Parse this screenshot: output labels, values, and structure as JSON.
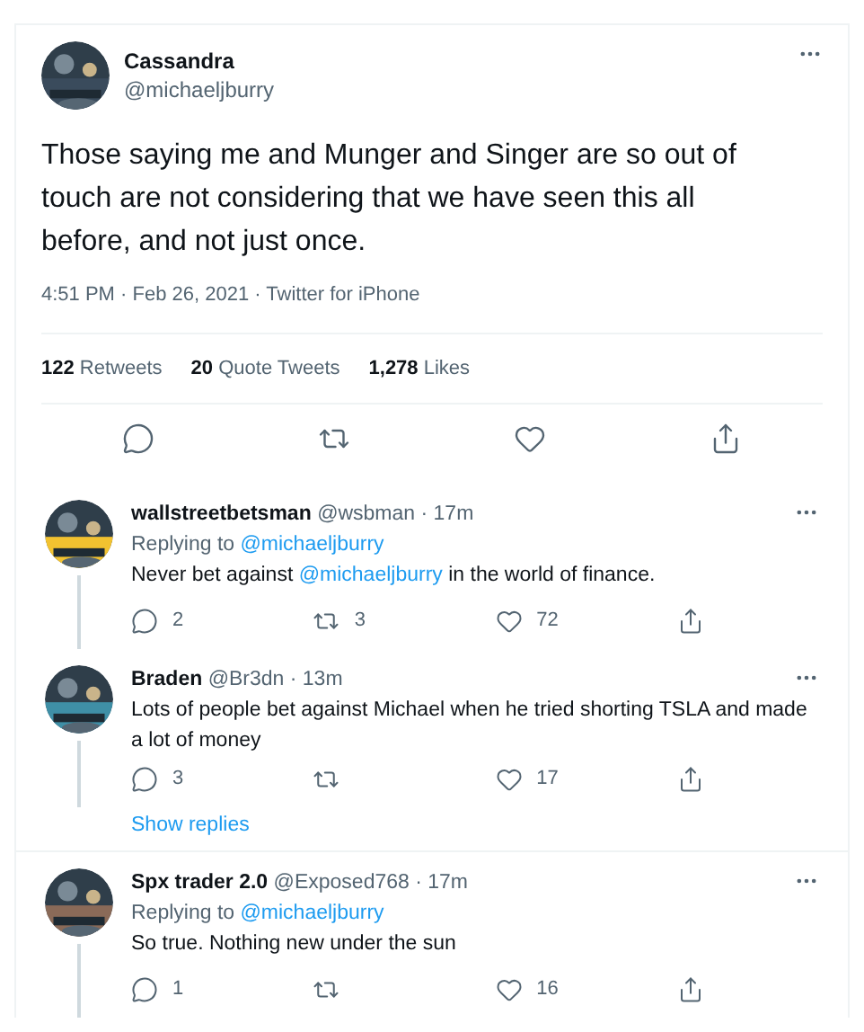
{
  "tweet": {
    "name": "Cassandra",
    "handle": "@michaeljburry",
    "text": "Those saying me and Munger and Singer are so out of touch are not considering that we have seen this all before, and not just once.",
    "meta": "4:51 PM · Feb 26, 2021 · Twitter for iPhone",
    "stats": [
      {
        "count": "122",
        "label": "Retweets"
      },
      {
        "count": "20",
        "label": "Quote Tweets"
      },
      {
        "count": "1,278",
        "label": "Likes"
      }
    ]
  },
  "replies": [
    {
      "name": "wallstreetbetsman",
      "handle": "@wsbman · 17m",
      "replying_to": "Replying to",
      "reply_handle": "@michaeljburry",
      "text": [
        {
          "kind": "plain",
          "text": "Never bet against "
        },
        {
          "kind": "mention",
          "text": "@michaeljburry"
        },
        {
          "kind": "plain",
          "text": " in the world of finance."
        }
      ],
      "actions": [
        {
          "kind": "reply",
          "count": "2"
        },
        {
          "kind": "retweet",
          "count": "3"
        },
        {
          "kind": "like",
          "count": "72"
        },
        {
          "kind": "share"
        }
      ],
      "thread_below": true
    },
    {
      "name": "Braden",
      "handle": "@Br3dn · 13m",
      "text": [
        {
          "kind": "plain",
          "text": "Lots of people bet against Michael when he tried shorting TSLA and made a lot of money"
        }
      ],
      "actions": [
        {
          "kind": "reply",
          "count": "3"
        },
        {
          "kind": "retweet"
        },
        {
          "kind": "like",
          "count": "17"
        },
        {
          "kind": "share"
        }
      ],
      "thread_below": true,
      "show_replies": "Show replies"
    },
    {
      "name": "Spx trader 2.0",
      "handle": "@Exposed768 · 17m",
      "replying_to": "Replying to",
      "reply_handle": "@michaeljburry",
      "text": [
        {
          "kind": "plain",
          "text": "So true. Nothing new under the sun"
        }
      ],
      "actions": [
        {
          "kind": "reply",
          "count": "1"
        },
        {
          "kind": "retweet"
        },
        {
          "kind": "like",
          "count": "16"
        },
        {
          "kind": "share"
        }
      ],
      "thread_below": true
    }
  ]
}
